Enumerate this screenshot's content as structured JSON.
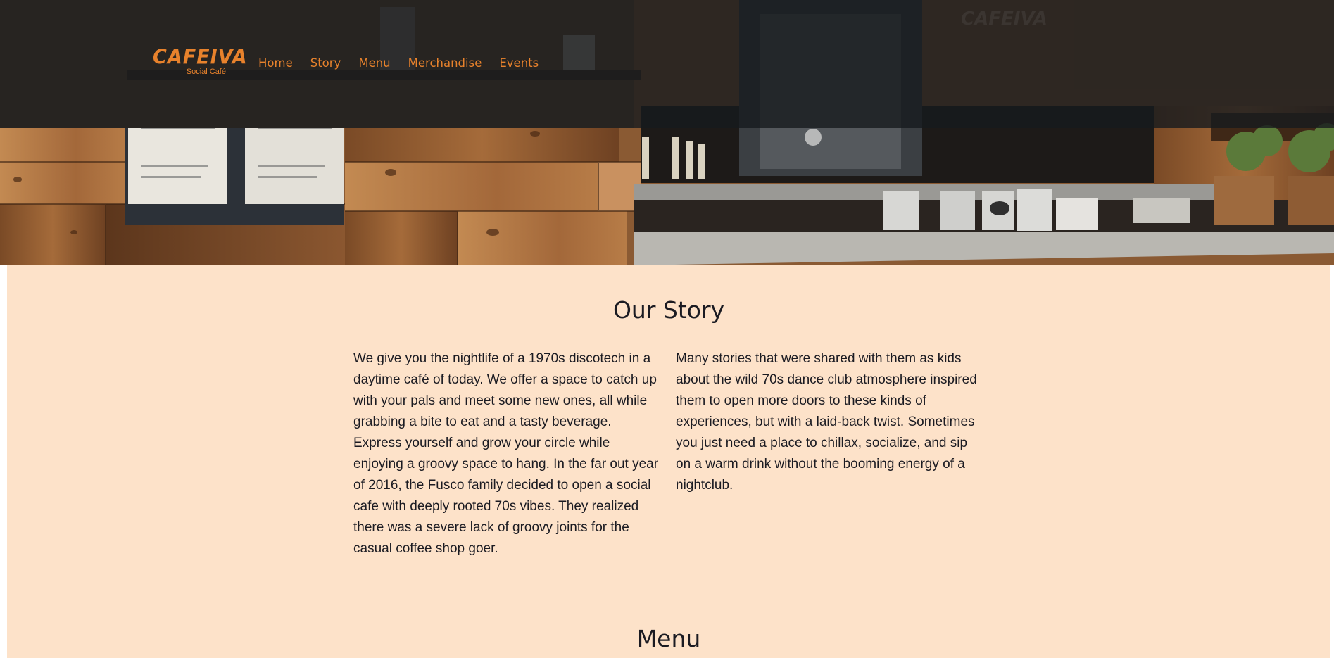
{
  "header": {
    "logo": {
      "name": "CAFEIVA",
      "tagline": "Social Café"
    },
    "nav": [
      {
        "label": "Home"
      },
      {
        "label": "Story"
      },
      {
        "label": "Menu"
      },
      {
        "label": "Merchandise"
      },
      {
        "label": "Events"
      }
    ]
  },
  "story": {
    "title": "Our Story",
    "paragraph_left": "We give you the nightlife of a 1970s discotech in a daytime café of today. We offer a space to catch up with your pals and meet some new ones, all while grabbing a bite to eat and a tasty beverage. Express yourself and grow your circle while enjoying a groovy space to hang. In the far out year of 2016, the Fusco family decided to open a social cafe with deeply rooted 70s vibes. They realized there was a severe lack of groovy joints for the casual coffee shop goer.",
    "paragraph_right": "Many stories that were shared with them as kids about the wild 70s dance club atmosphere inspired them to open more doors to these kinds of experiences, but with a laid-back twist. Sometimes you just need a place to chillax, socialize, and sip on a warm drink without the booming energy of a nightclub."
  },
  "menu": {
    "title": "Menu"
  },
  "colors": {
    "accent": "#e8822c",
    "section_background": "#fde2c9",
    "text": "#1b1b22",
    "nav_overlay": "#161a1e"
  }
}
